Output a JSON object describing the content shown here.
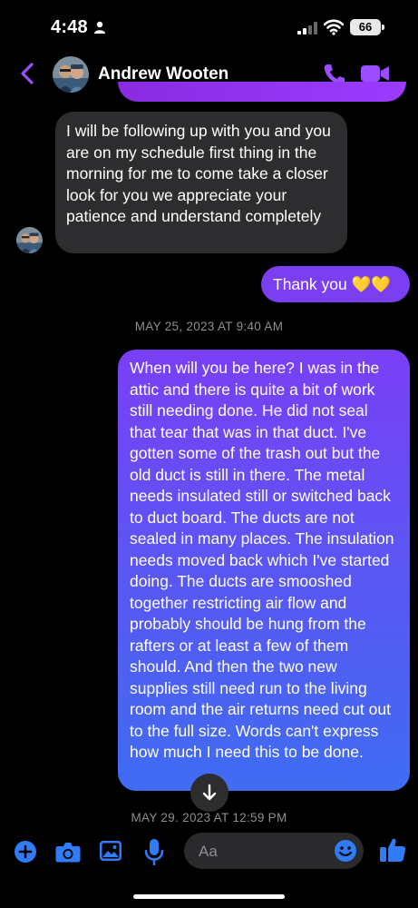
{
  "status_bar": {
    "time": "4:48",
    "battery": "66"
  },
  "header": {
    "contact_name": "Andrew Wooten"
  },
  "messages": [
    {
      "direction": "incoming",
      "text": "I will be following up with you and you are on my schedule first thing in the morning for me to come take a closer look for you we appreciate your patience and understand completely"
    },
    {
      "direction": "outgoing",
      "text": "Thank you 💛💛"
    },
    {
      "timestamp": "MAY 25, 2023 AT 9:40 AM"
    },
    {
      "direction": "outgoing",
      "text": "When will you be here? I was in the attic and there is quite a bit of work still needing done. He did not seal that tear that was in that duct. I've gotten some of the trash out but the old duct is still in there. The metal needs insulated still or switched back to duct board. The ducts are not sealed in many places. The insulation needs moved back which I've started doing. The ducts are smooshed together restricting air flow and probably should be hung from the rafters or at least a few of them should. And then the two new supplies still need run to the living room and the air returns need cut out to the full size. Words can't express how much I need this to be done."
    },
    {
      "timestamp": "MAY 29, 2023 AT 12:59 PM"
    }
  ],
  "composer": {
    "placeholder": "Aa"
  },
  "icons": {
    "back": "chevron-left-icon",
    "call": "phone-icon",
    "video": "video-camera-icon",
    "add": "plus-icon",
    "camera": "camera-icon",
    "gallery": "image-icon",
    "mic": "microphone-icon",
    "emoji": "emoji-icon",
    "like": "thumbs-up-icon",
    "scroll": "arrow-down-icon"
  },
  "colors": {
    "accent": "#9b4dff",
    "composer_accent": "#2f7cf6",
    "incoming_bubble": "#2d2d2f",
    "outgoing_top": "#7a3ff5",
    "outgoing_bottom": "#3f6cf2",
    "timestamp": "#8e8e93"
  }
}
